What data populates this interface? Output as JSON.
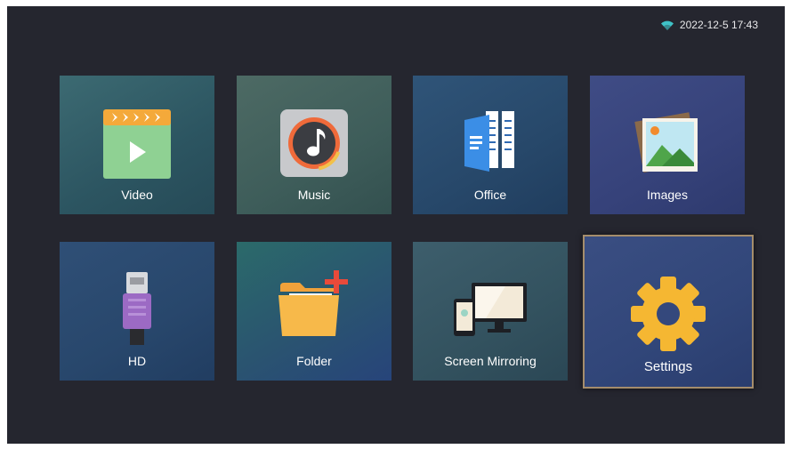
{
  "status": {
    "datetime": "2022-12-5 17:43",
    "wifi_icon": "wifi-icon"
  },
  "tiles": {
    "video": {
      "label": "Video",
      "icon": "video-icon"
    },
    "music": {
      "label": "Music",
      "icon": "music-icon"
    },
    "office": {
      "label": "Office",
      "icon": "office-icon"
    },
    "images": {
      "label": "Images",
      "icon": "images-icon"
    },
    "hd": {
      "label": "HD",
      "icon": "hdmi-icon"
    },
    "folder": {
      "label": "Folder",
      "icon": "folder-icon"
    },
    "mirror": {
      "label": "Screen Mirroring",
      "icon": "screen-mirroring-icon"
    },
    "settings": {
      "label": "Settings",
      "icon": "gear-icon",
      "selected": true
    }
  },
  "colors": {
    "background": "#25262f",
    "wifi": "#3fc2c7",
    "focus_border": "#a58d6c",
    "settings_gear": "#f5b732"
  }
}
